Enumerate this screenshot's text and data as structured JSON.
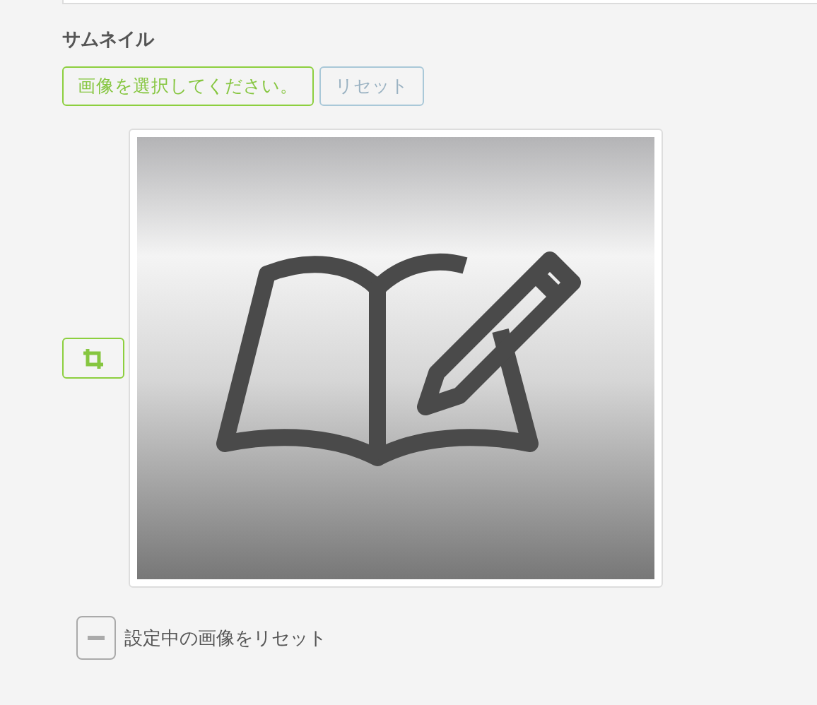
{
  "section": {
    "title": "サムネイル"
  },
  "buttons": [
    {
      "kind": "select",
      "label": "画像を選択してください。"
    },
    {
      "kind": "reset",
      "label": "リセット"
    }
  ],
  "reset_option": {
    "label": "設定中の画像をリセット"
  }
}
